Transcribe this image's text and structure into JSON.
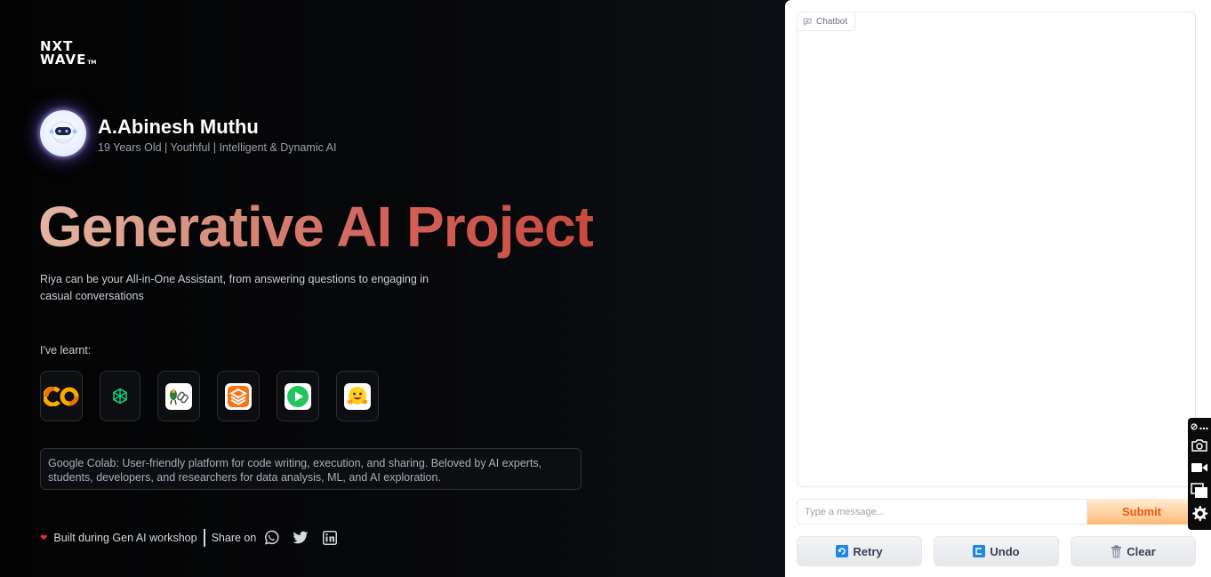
{
  "brand": {
    "line1": "NXT",
    "line2": "WAVE",
    "tm": "TM"
  },
  "profile": {
    "name": "A.Abinesh Muthu",
    "subtitle": "19 Years Old | Youthful | Intelligent & Dynamic AI",
    "avatar_icon": "robot-icon"
  },
  "headline": "Generative AI Project",
  "description": "Riya can be your All-in-One Assistant, from answering questions to engaging in casual conversations",
  "learnt_label": "I've learnt:",
  "tools": [
    {
      "name": "google-colab-icon"
    },
    {
      "name": "openai-icon"
    },
    {
      "name": "langchain-icon"
    },
    {
      "name": "gradio-icon"
    },
    {
      "name": "playht-icon"
    },
    {
      "name": "huggingface-icon"
    }
  ],
  "info_text": "Google Colab: User-friendly platform for code writing, execution, and sharing. Beloved by AI experts, students, developers, and researchers for data analysis, ML, and AI exploration.",
  "footer": {
    "built_text": "Built during Gen AI workshop",
    "share_label": "Share on",
    "share_icons": [
      "whatsapp-icon",
      "twitter-icon",
      "linkedin-icon"
    ]
  },
  "chat": {
    "label": "Chatbot",
    "input_placeholder": "Type a message...",
    "submit_label": "Submit",
    "retry_label": "Retry",
    "undo_label": "Undo",
    "clear_label": "Clear"
  },
  "colors": {
    "headline_gradient_start": "#e3b6a2",
    "headline_gradient_end": "#c94a3d",
    "submit_text": "#ea580c",
    "heart": "#e0303c"
  }
}
